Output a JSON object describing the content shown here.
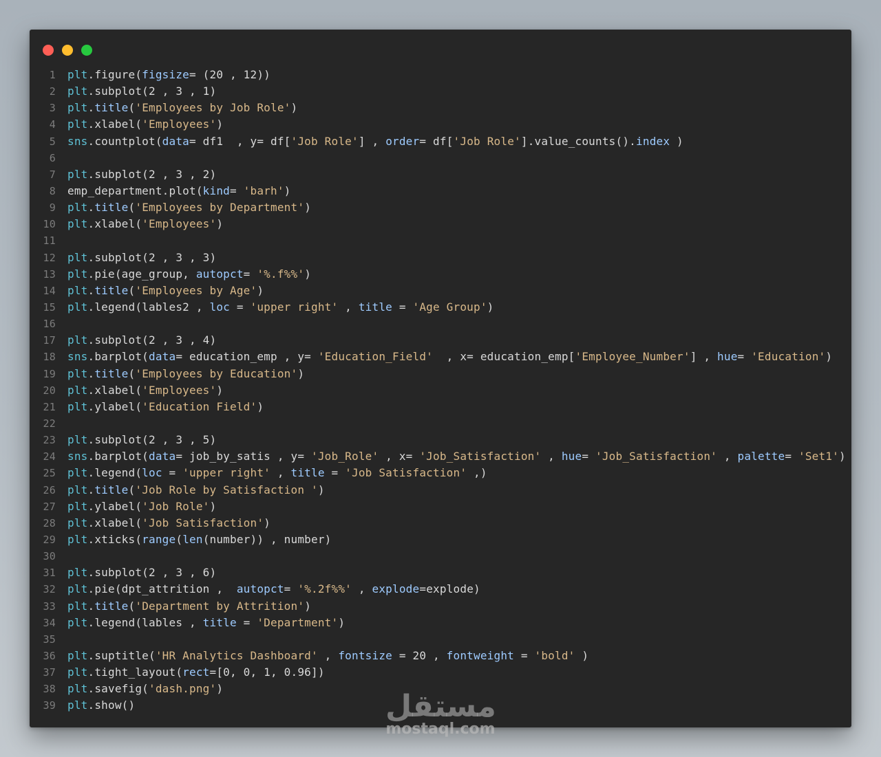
{
  "window": {
    "controls": [
      "close",
      "minimize",
      "maximize"
    ]
  },
  "code": {
    "lines": [
      {
        "n": "1",
        "text": "plt.figure(figsize= (20 , 12))"
      },
      {
        "n": "2",
        "text": "plt.subplot(2 , 3 , 1)"
      },
      {
        "n": "3",
        "text": "plt.title('Employees by Job Role')"
      },
      {
        "n": "4",
        "text": "plt.xlabel('Employees')"
      },
      {
        "n": "5",
        "text": "sns.countplot(data= df1  , y= df['Job Role'] , order= df['Job Role'].value_counts().index )"
      },
      {
        "n": "6",
        "text": ""
      },
      {
        "n": "7",
        "text": "plt.subplot(2 , 3 , 2)"
      },
      {
        "n": "8",
        "text": "emp_department.plot(kind= 'barh')"
      },
      {
        "n": "9",
        "text": "plt.title('Employees by Department')"
      },
      {
        "n": "10",
        "text": "plt.xlabel('Employees')"
      },
      {
        "n": "11",
        "text": ""
      },
      {
        "n": "12",
        "text": "plt.subplot(2 , 3 , 3)"
      },
      {
        "n": "13",
        "text": "plt.pie(age_group, autopct= '%.f%%')"
      },
      {
        "n": "14",
        "text": "plt.title('Employees by Age')"
      },
      {
        "n": "15",
        "text": "plt.legend(lables2 , loc = 'upper right' , title = 'Age Group')"
      },
      {
        "n": "16",
        "text": ""
      },
      {
        "n": "17",
        "text": "plt.subplot(2 , 3 , 4)"
      },
      {
        "n": "18",
        "text": "sns.barplot(data= education_emp , y= 'Education_Field'  , x= education_emp['Employee_Number'] , hue= 'Education')"
      },
      {
        "n": "19",
        "text": "plt.title('Employees by Education')"
      },
      {
        "n": "20",
        "text": "plt.xlabel('Employees')"
      },
      {
        "n": "21",
        "text": "plt.ylabel('Education Field')"
      },
      {
        "n": "22",
        "text": ""
      },
      {
        "n": "23",
        "text": "plt.subplot(2 , 3 , 5)"
      },
      {
        "n": "24",
        "text": "sns.barplot(data= job_by_satis , y= 'Job_Role' , x= 'Job_Satisfaction' , hue= 'Job_Satisfaction' , palette= 'Set1')"
      },
      {
        "n": "25",
        "text": "plt.legend(loc = 'upper right' , title = 'Job Satisfaction' ,)"
      },
      {
        "n": "26",
        "text": "plt.title('Job Role by Satisfaction ')"
      },
      {
        "n": "27",
        "text": "plt.ylabel('Job Role')"
      },
      {
        "n": "28",
        "text": "plt.xlabel('Job Satisfaction')"
      },
      {
        "n": "29",
        "text": "plt.xticks(range(len(number)) , number)"
      },
      {
        "n": "30",
        "text": ""
      },
      {
        "n": "31",
        "text": "plt.subplot(2 , 3 , 6)"
      },
      {
        "n": "32",
        "text": "plt.pie(dpt_attrition ,  autopct= '%.2f%%' , explode=explode)"
      },
      {
        "n": "33",
        "text": "plt.title('Department by Attrition')"
      },
      {
        "n": "34",
        "text": "plt.legend(lables , title = 'Department')"
      },
      {
        "n": "35",
        "text": ""
      },
      {
        "n": "36",
        "text": "plt.suptitle('HR Analytics Dashboard' , fontsize = 20 , fontweight = 'bold' )"
      },
      {
        "n": "37",
        "text": "plt.tight_layout(rect=[0, 0, 1, 0.96])"
      },
      {
        "n": "38",
        "text": "plt.savefig('dash.png')"
      },
      {
        "n": "39",
        "text": "plt.show()"
      }
    ]
  },
  "watermark": {
    "arabic": "مستقل",
    "latin": "mostaql.com"
  },
  "colors": {
    "editor_bg": "#262626",
    "object": "#5fc2d6",
    "string": "#d9b98a",
    "text": "#d9d9d9",
    "line_number": "#7c7c7c",
    "close": "#ff5f56",
    "minimize": "#ffbd2e",
    "maximize": "#27c93f"
  }
}
